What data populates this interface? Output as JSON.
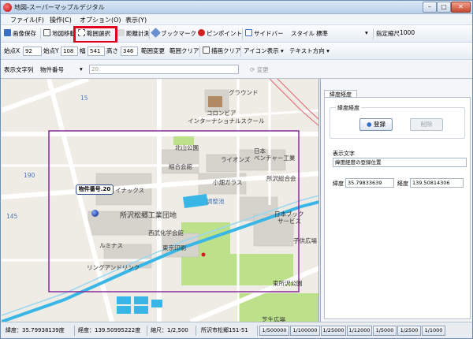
{
  "window": {
    "title": "地図-スーパーマップルデジタル"
  },
  "menu": [
    "ファイル(F)",
    "操作(C)",
    "オプション(O)",
    "表示(Y)"
  ],
  "toolbar1": {
    "save_image": "画像保存",
    "map_move": "地図移動",
    "range_select": "範囲選択",
    "distance": "距離計測",
    "bookmark": "ブックマーク",
    "pinpoint": "ピンポイント",
    "sidebar": "サイドバー",
    "style_label": "スタイル",
    "style_value": "標準",
    "scale_label": "指定縮尺",
    "scale_value": "1000"
  },
  "toolbar2": {
    "start_x_label": "始点X",
    "start_x": "92",
    "start_y_label": "始点Y",
    "start_y": "108",
    "width_label": "幅",
    "width": "541",
    "height_label": "高さ",
    "height": "346",
    "range_change": "範囲変更",
    "range_clear": "範囲クリア",
    "draw_clear": "描画クリア",
    "icon_display": "アイコン表示",
    "text_direction": "テキスト方向"
  },
  "toolbar3": {
    "display_string_label": "表示文字列",
    "display_string_value": "物件番号",
    "input_value": "20",
    "change_button": "変更"
  },
  "map": {
    "callout": "物件番号.20",
    "labels": {
      "ground": "グラウンド",
      "conpri": "コロンビア",
      "school": "インターナショナルスクール",
      "park_north": "北山公園",
      "lions": "ライオンズ",
      "nihon_venture": "日本",
      "venture": "ベンチャー工業",
      "kumiai": "組合会館",
      "tokorozawa_glass": "小畑ガラス",
      "tokorozawa_union": "所沢総合会",
      "inox": "イナックス",
      "pond": "調整池",
      "industrial": "所沢松郷工業団地",
      "nihon_book": "日本ブック",
      "service": "サービス",
      "saibu": "西武化学会館",
      "lumina": "ルミナス",
      "toshin": "東京印刷",
      "ring": "リングアンドリンク",
      "kodomo": "子供広場",
      "higashi_park": "東所沢公園",
      "bottom_label": "芝生広場",
      "n1": "190",
      "n2": "145",
      "n3": "15"
    }
  },
  "sidebar": {
    "tab": "緯度経度",
    "group_label": "緯度経度",
    "register_button": "登録",
    "delete_button": "削除",
    "display_text_label": "表示文字",
    "display_text_value": "緯度経度の登録位置",
    "lat_label": "緯度",
    "lat_value": "35.79833639",
    "lon_label": "経度",
    "lon_value": "139.50814306"
  },
  "status": {
    "lat": "緯度：35.79938139度",
    "lon": "経度：139.50995222度",
    "scale": "縮尺：1/2,500",
    "address": "所沢市松郷151-51",
    "scales": [
      "1/500000",
      "1/100000",
      "1/25000",
      "1/12000",
      "1/5000",
      "1/2500",
      "1/1000"
    ]
  },
  "colors": {
    "highlight": "#e0001b",
    "selection": "#8a2a9a",
    "water": "#39b6e6",
    "park": "#bde08a"
  }
}
